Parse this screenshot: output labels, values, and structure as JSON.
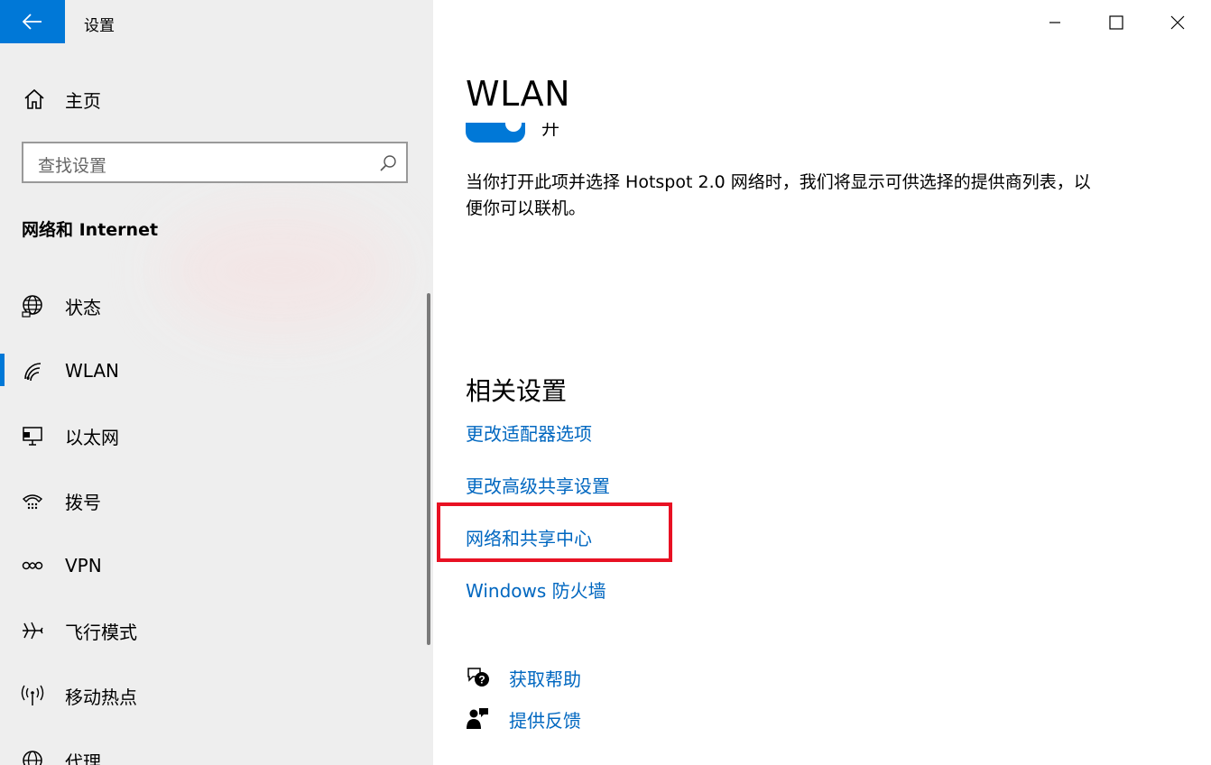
{
  "window": {
    "title": "设置",
    "controls": [
      "minimize-icon",
      "maximize-icon",
      "close-icon"
    ]
  },
  "sidebar": {
    "back_icon": "back-arrow-icon",
    "home_label": "主页",
    "home_icon": "home-icon",
    "search_placeholder": "查找设置",
    "search_icon": "search-icon",
    "section_title": "网络和 Internet",
    "items": [
      {
        "label": "状态",
        "icon": "globe-status-icon"
      },
      {
        "label": "WLAN",
        "icon": "wifi-icon",
        "active": true
      },
      {
        "label": "以太网",
        "icon": "ethernet-icon"
      },
      {
        "label": "拨号",
        "icon": "dialup-icon"
      },
      {
        "label": "VPN",
        "icon": "vpn-icon"
      },
      {
        "label": "飞行模式",
        "icon": "airplane-icon"
      },
      {
        "label": "移动热点",
        "icon": "hotspot-icon"
      },
      {
        "label": "代理",
        "icon": "proxy-globe-icon"
      }
    ]
  },
  "main": {
    "page_title": "WLAN",
    "toggle": {
      "label": "开",
      "state": "on"
    },
    "description": "当你打开此项并选择 Hotspot 2.0 网络时，我们将显示可供选择的提供商列表，以便你可以联机。",
    "related": {
      "title": "相关设置",
      "links": [
        "更改适配器选项",
        "更改高级共享设置",
        "网络和共享中心",
        "Windows 防火墙"
      ],
      "highlighted_link": "网络和共享中心"
    },
    "help": {
      "get_help": "获取帮助",
      "feedback": "提供反馈"
    }
  },
  "colors": {
    "accent": "#0078d7",
    "link": "#0067c0",
    "highlight_box": "#e81123",
    "sidebar_bg": "#eeeeee"
  }
}
